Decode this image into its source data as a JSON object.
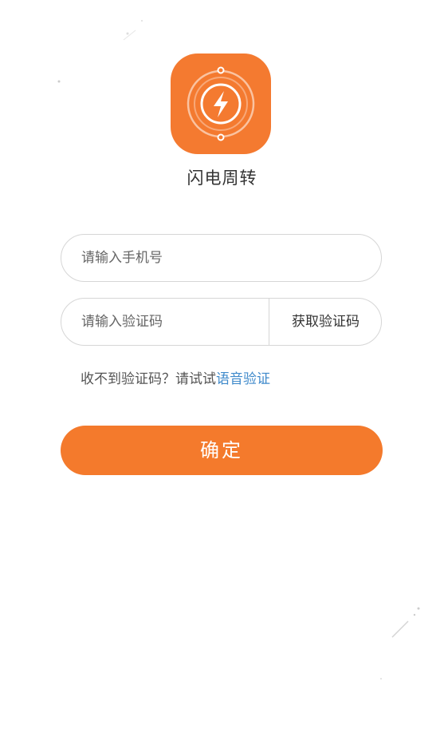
{
  "app": {
    "name": "闪电周转"
  },
  "form": {
    "phone_placeholder": "请输入手机号",
    "code_placeholder": "请输入验证码",
    "get_code_label": "获取验证码"
  },
  "hint": {
    "text": "收不到验证码？请试试",
    "link": "语音验证"
  },
  "confirm_label": "确定",
  "colors": {
    "accent": "#f47a2c",
    "link": "#3f8acb",
    "border": "#d6d6d6"
  },
  "icons": {
    "logo": "lightning-bolt-icon"
  }
}
